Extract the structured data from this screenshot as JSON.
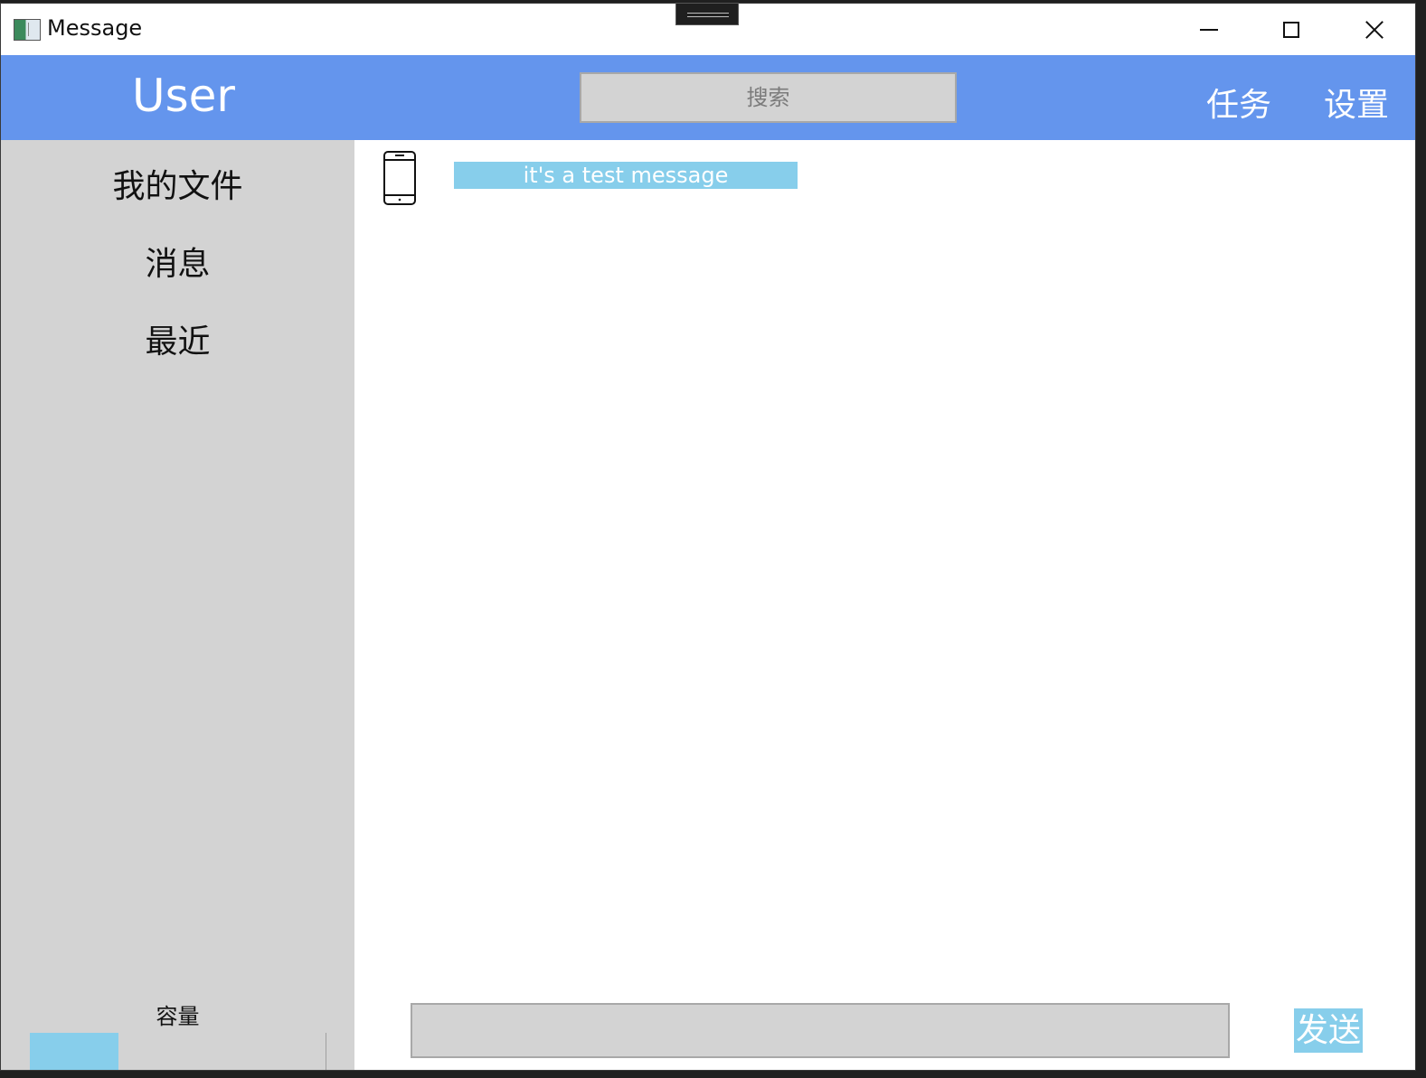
{
  "window": {
    "title": "Message"
  },
  "header": {
    "user_label": "User",
    "search_placeholder": "搜索",
    "nav": {
      "task": "任务",
      "settings": "设置"
    },
    "accent_color": "#6495ed"
  },
  "sidebar": {
    "items": [
      {
        "label": "我的文件"
      },
      {
        "label": "消息"
      },
      {
        "label": "最近"
      }
    ],
    "capacity": {
      "label": "容量",
      "used_fraction": 0.3
    },
    "background_color": "#d3d3d3"
  },
  "messages": [
    {
      "icon": "phone-icon",
      "text": "it's a test message"
    }
  ],
  "composer": {
    "input_value": "",
    "send_label": "发送",
    "button_color": "#87ceeb"
  }
}
